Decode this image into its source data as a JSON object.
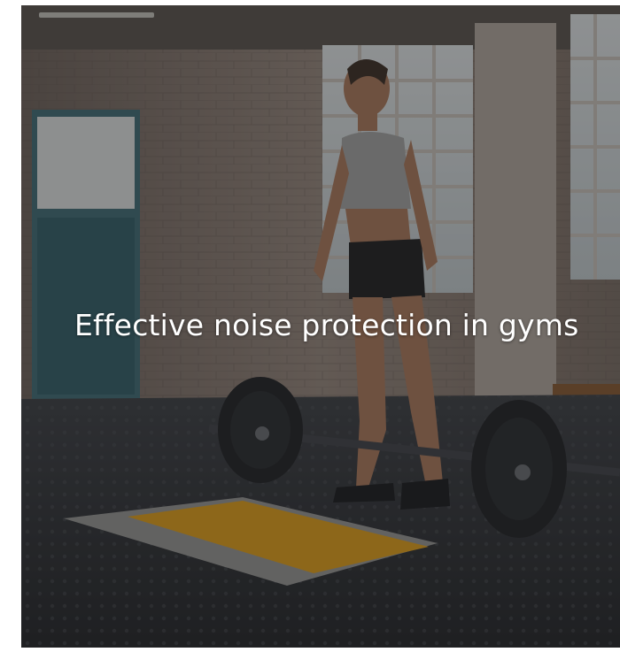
{
  "hero": {
    "caption": "Effective noise protection in gyms"
  },
  "colors": {
    "overlay": "#1e1e1e",
    "mat_accent": "#e8a317",
    "wall_brick": "#8a7a70",
    "floor": "#2b2d31",
    "caption_text": "#ffffff"
  },
  "icons": {
    "scene": "gym-photo"
  }
}
